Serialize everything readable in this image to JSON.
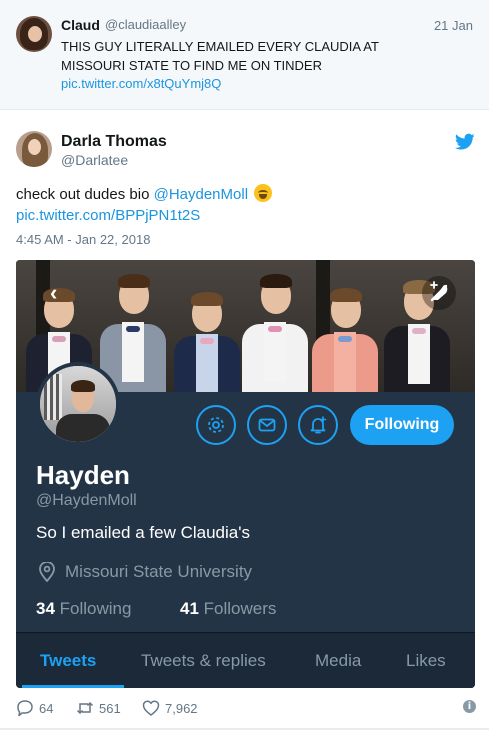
{
  "parent_tweet": {
    "name": "Claud",
    "handle": "@claudiaalley",
    "date": "21 Jan",
    "text": "THIS GUY LITERALLY EMAILED EVERY CLAUDIA AT MISSOURI STATE TO FIND ME ON TINDER",
    "link": "pic.twitter.com/x8tQuYmj8Q"
  },
  "tweet": {
    "name": "Darla Thomas",
    "handle": "@Darlatee",
    "text_prefix": "check out dudes bio ",
    "mention": "@HaydenMoll",
    "link": "pic.twitter.com/BPPjPN1t2S",
    "timestamp": "4:45 AM - Jan 22, 2018"
  },
  "embed": {
    "follow_label": "Following",
    "name": "Hayden",
    "handle": "@HaydenMoll",
    "bio": "So I emailed a few Claudia's",
    "location": "Missouri State University",
    "following_count": "34",
    "following_label": "Following",
    "followers_count": "41",
    "followers_label": "Followers",
    "tabs": [
      {
        "label": "Tweets",
        "active": true
      },
      {
        "label": "Tweets & replies",
        "active": false
      },
      {
        "label": "Media",
        "active": false
      },
      {
        "label": "Likes",
        "active": false
      }
    ]
  },
  "actions": {
    "replies": "64",
    "retweets": "561",
    "likes": "7,962"
  },
  "colors": {
    "accent": "#1da1f2",
    "link": "#1b95e0",
    "dark_bg": "#243447"
  },
  "icons": [
    "twitter-bird-icon",
    "back-chevron-icon",
    "compose-icon",
    "gear-icon",
    "envelope-icon",
    "bell-plus-icon",
    "location-pin-icon",
    "reply-icon",
    "retweet-icon",
    "heart-icon",
    "info-icon"
  ]
}
